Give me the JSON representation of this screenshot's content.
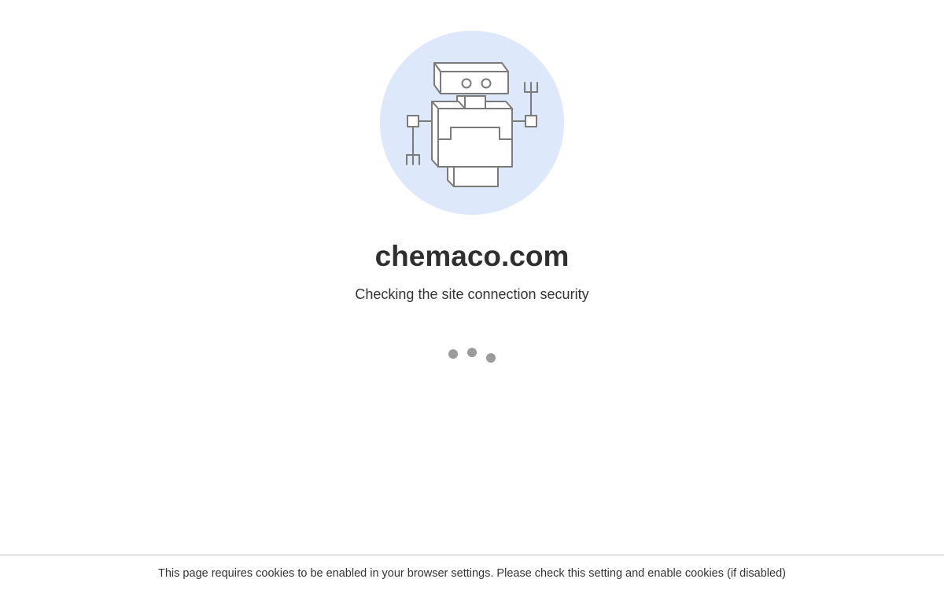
{
  "domain_title": "chemaco.com",
  "status_message": "Checking the site connection security",
  "loading_indicator": "three-dot-loader",
  "footer": {
    "notice": "This page requires cookies to be enabled in your browser settings. Please check this setting and enable cookies (if disabled)"
  },
  "illustration": {
    "icon": "robot-icon",
    "circle_color": "#dde9fa",
    "stroke_color": "#7a7a7a"
  },
  "colors": {
    "background": "#ffffff",
    "title": "#2f2f2f",
    "text": "#333333",
    "dots": "#9b9b9b",
    "divider": "#bfbfbf"
  }
}
